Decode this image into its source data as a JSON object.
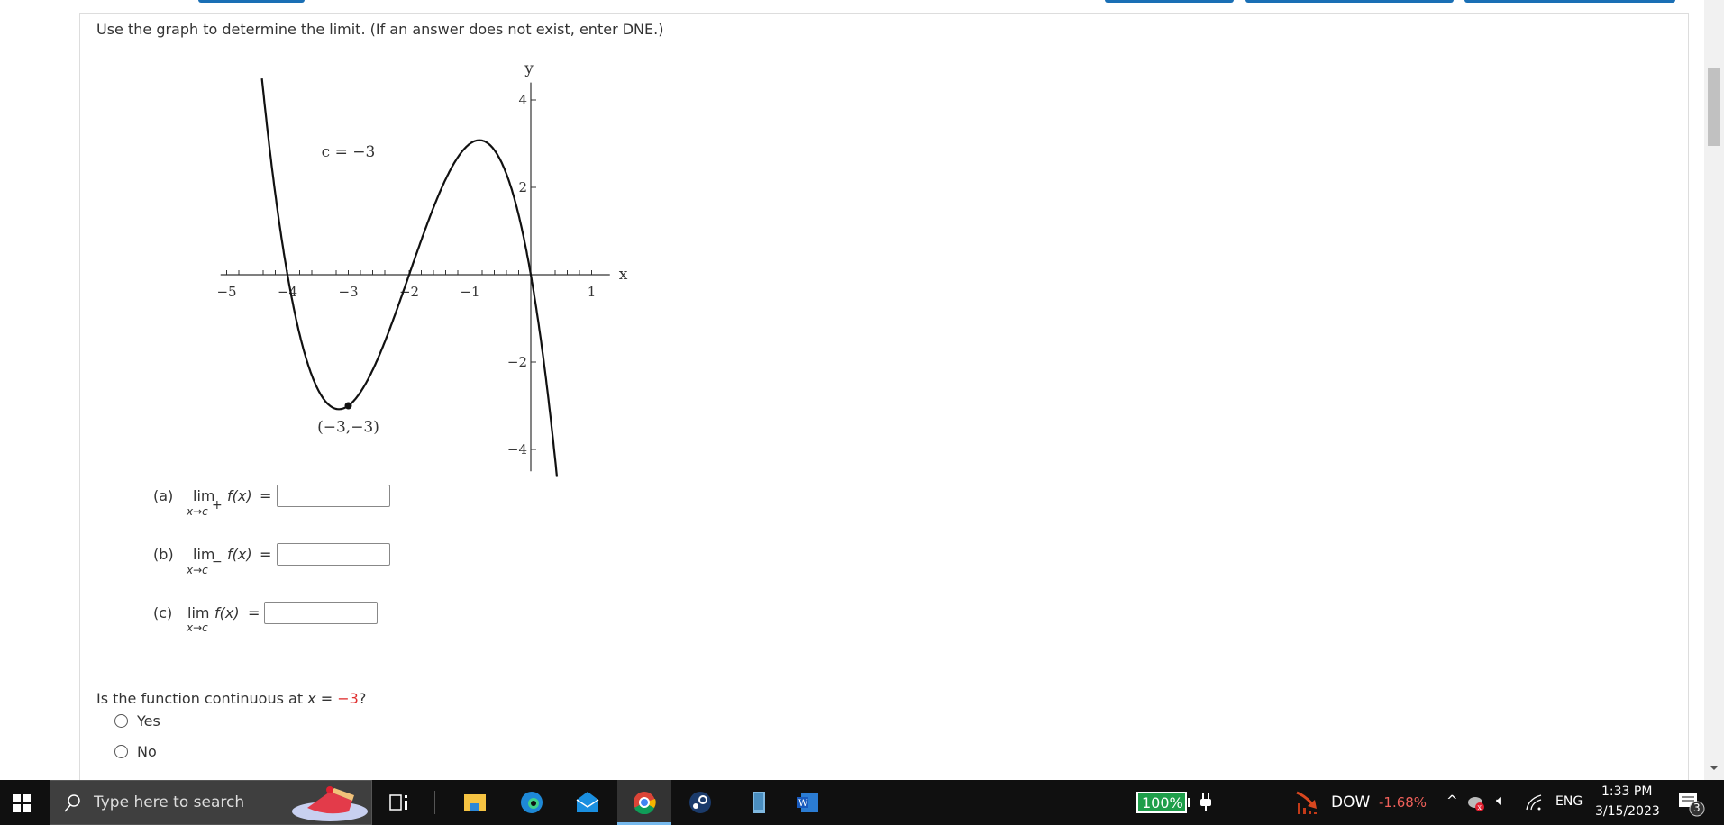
{
  "question": {
    "instruction": "Use the graph to determine the limit. (If an answer does not exist, enter DNE.)",
    "parts": [
      {
        "label": "(a)",
        "lim": "lim",
        "sub": "x→c",
        "dir": "+",
        "func": "f(x)",
        "eq": "=",
        "value": ""
      },
      {
        "label": "(b)",
        "lim": "lim",
        "sub": "x→c",
        "dir": "−",
        "func": "f(x)",
        "eq": "=",
        "value": ""
      },
      {
        "label": "(c)",
        "lim": "lim",
        "sub": "x→c",
        "dir": "",
        "func": "f(x)",
        "eq": "=",
        "value": ""
      }
    ],
    "continuity": {
      "prefix": "Is the function continuous at ",
      "var": "x",
      "eq": " = ",
      "value": "−3",
      "suffix": "?",
      "value_color": "#e03030"
    },
    "options": [
      "Yes",
      "No"
    ]
  },
  "chart_data": {
    "type": "line",
    "function": "f(x) = -x(x+2)(x+4)",
    "xlabel": "x",
    "ylabel": "y",
    "xlim": [
      -5.1,
      1.3
    ],
    "ylim": [
      -4.5,
      4.5
    ],
    "x_ticks": [
      "−5",
      "−4",
      "−3",
      "−2",
      "−1",
      "1"
    ],
    "y_ticks": [
      "4",
      "2",
      "−2",
      "−4"
    ],
    "annotations": [
      "c = −3",
      "(−3,−3)"
    ],
    "point": {
      "x": -3,
      "y": -3
    },
    "grid": false
  },
  "taskbar": {
    "search_placeholder": "Type here to search",
    "battery": "100%",
    "stock_name": "DOW",
    "stock_change": "-1.68%",
    "language": "ENG",
    "time": "1:33 PM",
    "date": "3/15/2023",
    "notifications": "3"
  }
}
